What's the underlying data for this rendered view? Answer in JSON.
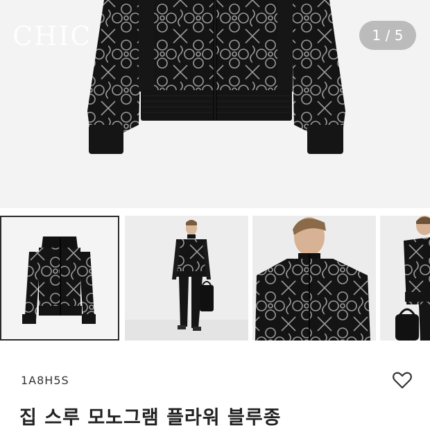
{
  "gallery": {
    "watermark": "CHIC",
    "counter": "1 / 5",
    "thumbnails": [
      {
        "label": "jacket-front",
        "selected": true
      },
      {
        "label": "model-full-body",
        "selected": false
      },
      {
        "label": "model-close-up",
        "selected": false
      },
      {
        "label": "model-side",
        "selected": false
      }
    ]
  },
  "product": {
    "code": "1A8H5S",
    "name": "집 스루 모노그램 플라워 블루종"
  },
  "icons": {
    "favorite": "heart-outline-icon"
  }
}
